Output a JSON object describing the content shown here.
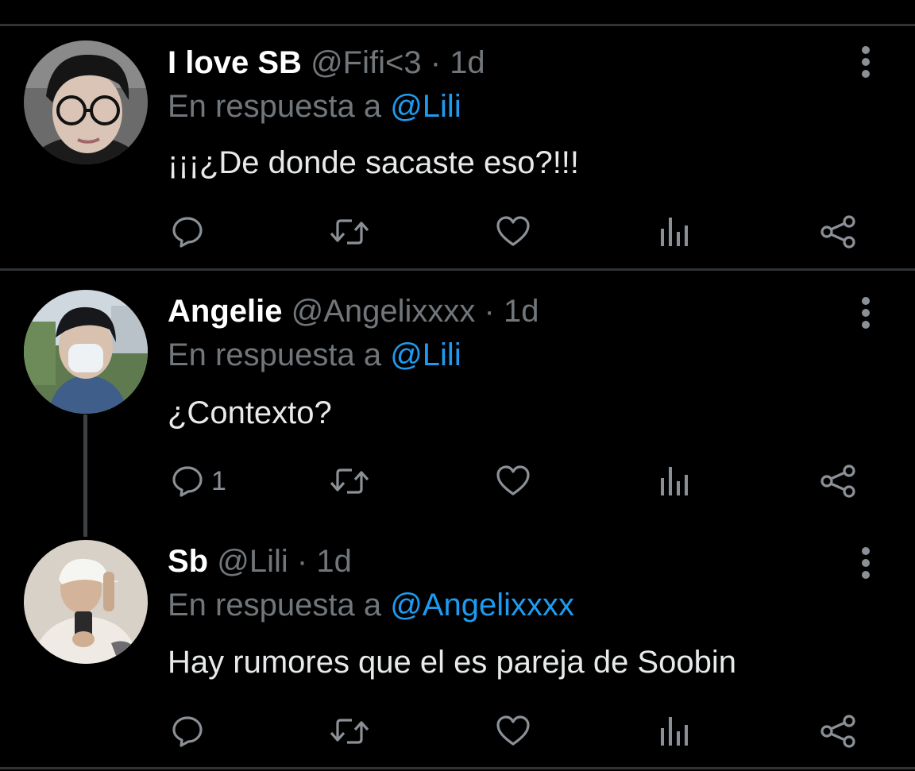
{
  "tweets": [
    {
      "name": "I love SB",
      "handle": "@Fifi<3",
      "separator": "·",
      "time": "1d",
      "reply_prefix": "En respuesta a",
      "reply_to": "@Lili",
      "text": "¡¡¡¿De donde sacaste eso?!!!",
      "reply_count": "",
      "avatar_icon": "avatar-photo-glasses"
    },
    {
      "name": "Angelie",
      "handle": "@Angelixxxx",
      "separator": "·",
      "time": "1d",
      "reply_prefix": "En respuesta a",
      "reply_to": "@Lili",
      "text": "¿Contexto?",
      "reply_count": "1",
      "avatar_icon": "avatar-photo-mask"
    },
    {
      "name": "Sb",
      "handle": "@Lili",
      "separator": "·",
      "time": "1d",
      "reply_prefix": "En respuesta a",
      "reply_to": "@Angelixxxx",
      "text": "Hay rumores que el es pareja de Soobin",
      "reply_count": "",
      "avatar_icon": "avatar-photo-cap"
    }
  ],
  "icons": {
    "reply": "reply-icon",
    "retweet": "retweet-icon",
    "like": "like-icon",
    "analytics": "analytics-icon",
    "share": "share-icon",
    "more": "more-options-icon"
  },
  "colors": {
    "background": "#000000",
    "name": "#ffffff",
    "secondary": "#71767b",
    "mention": "#1d9bf0",
    "icon": "#8b9096",
    "divider": "#2f3336"
  }
}
